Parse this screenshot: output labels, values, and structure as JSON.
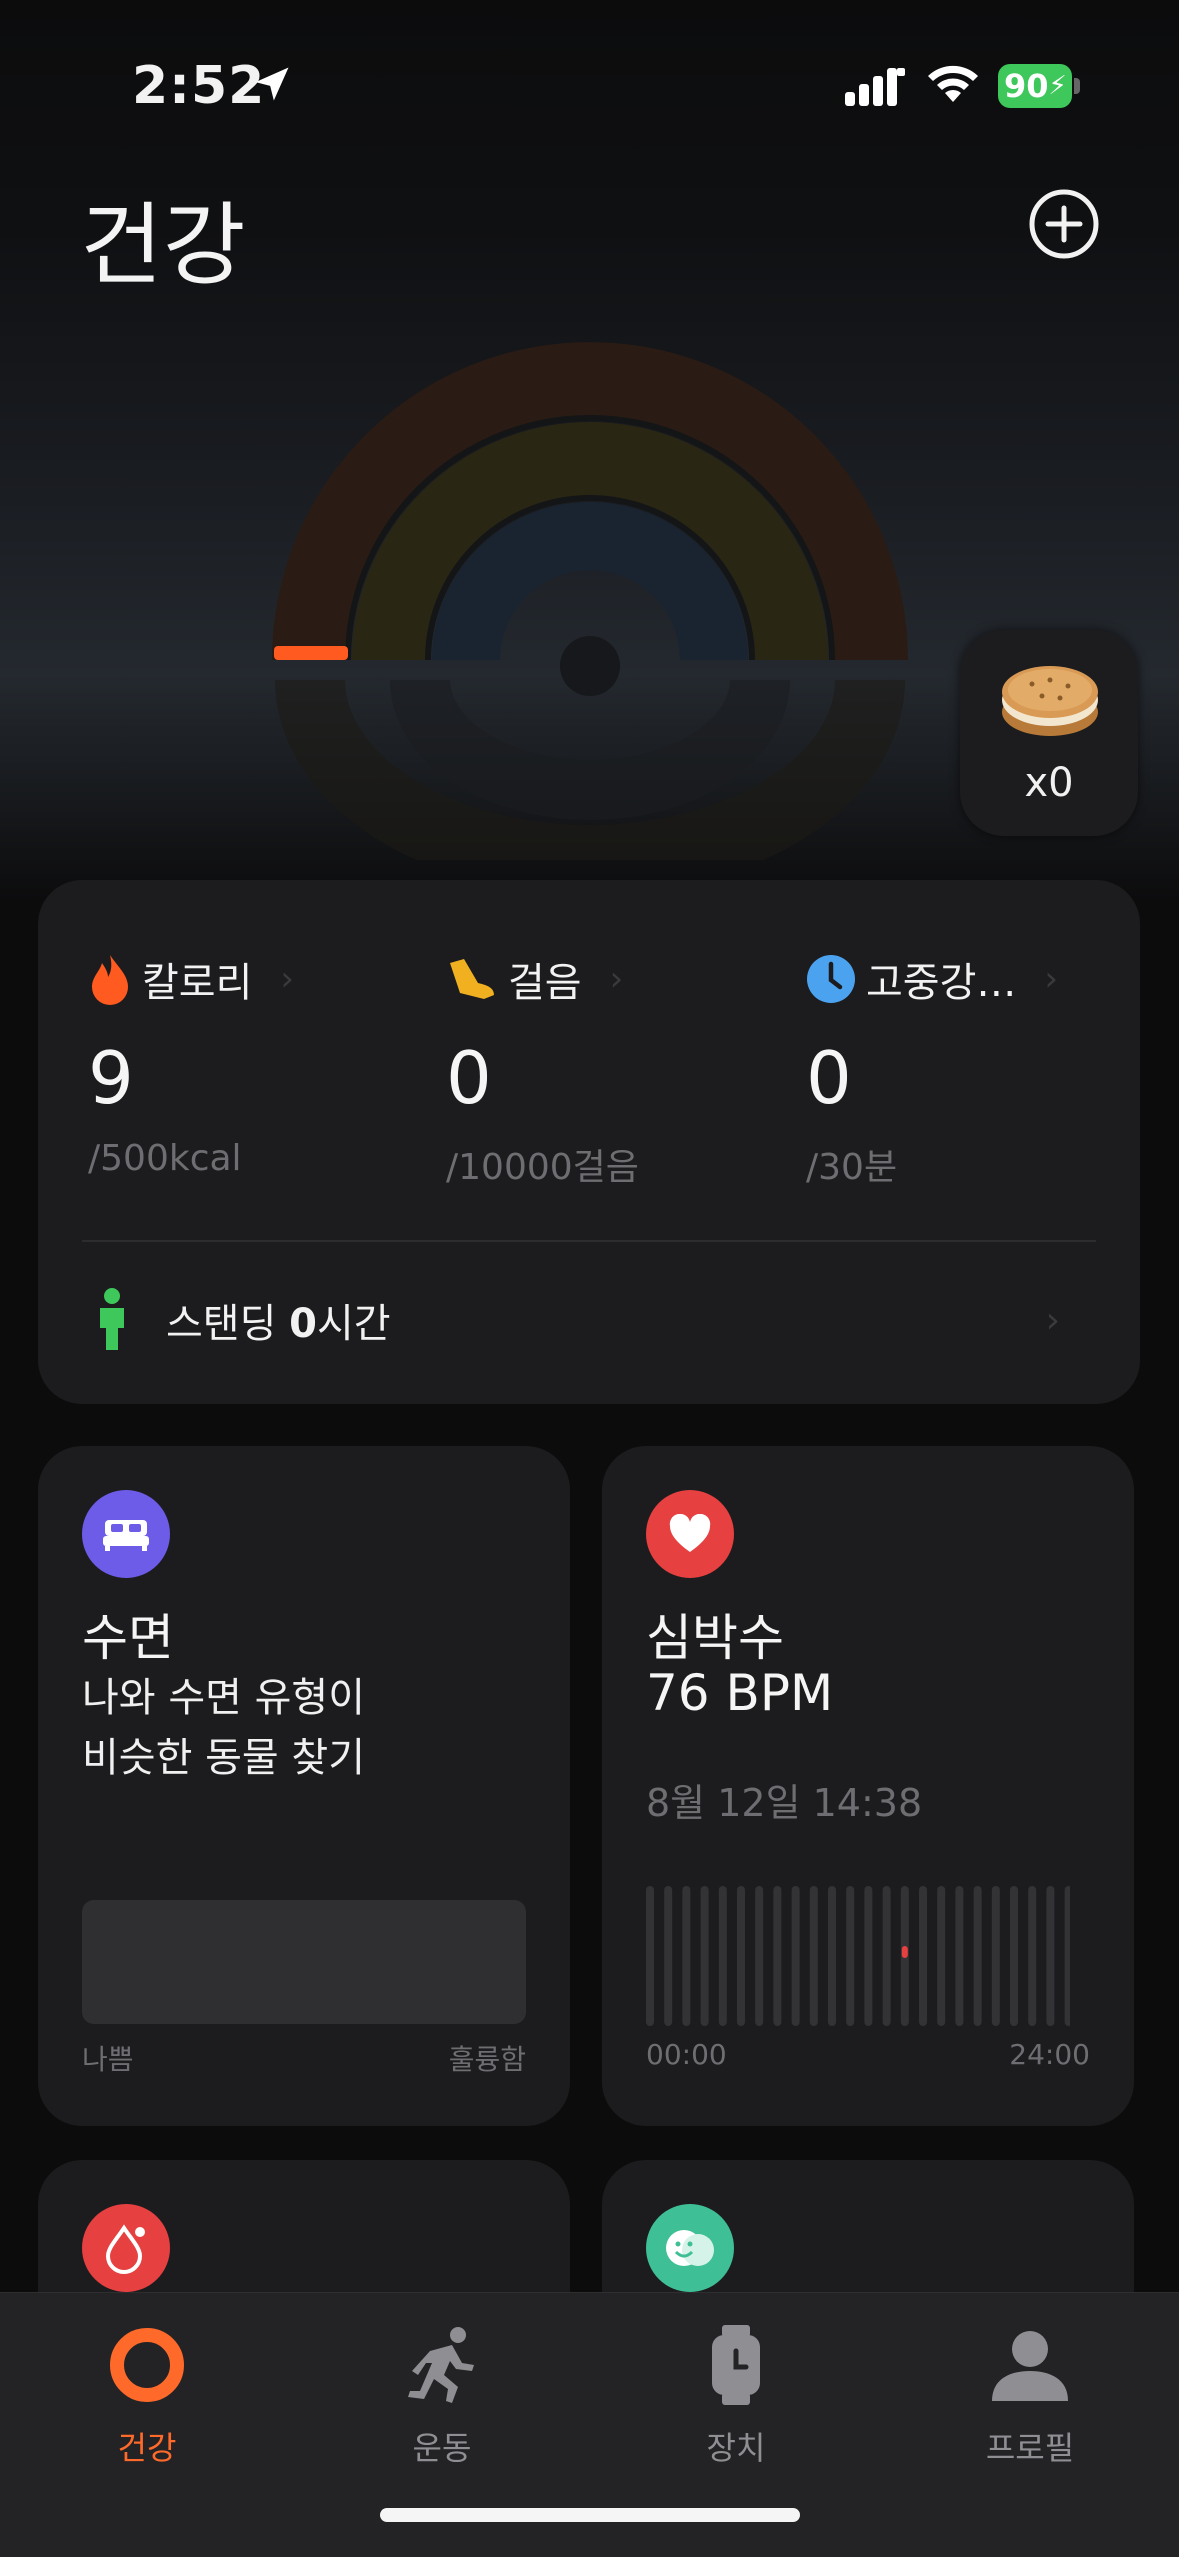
{
  "status_bar": {
    "time": "2:52",
    "battery": "90"
  },
  "header": {
    "title": "건강"
  },
  "coins": {
    "count_label": "x0"
  },
  "activity": {
    "metrics": [
      {
        "label": "칼로리",
        "value": "9",
        "goal": "/500kcal",
        "icon": "flame-icon"
      },
      {
        "label": "걸음",
        "value": "0",
        "goal": "/10000걸음",
        "icon": "shoe-icon"
      },
      {
        "label": "고중강…",
        "value": "0",
        "goal": "/30분",
        "icon": "clock-icon"
      }
    ],
    "standing": {
      "label": "스탠딩",
      "value": "0",
      "unit": "시간"
    }
  },
  "sleep": {
    "title": "수면",
    "line1": "나와 수면 유형이",
    "line2": "비슷한 동물 찾기",
    "scale_left": "나쁨",
    "scale_right": "훌륭함"
  },
  "heart": {
    "title": "심박수",
    "value": "76 BPM",
    "date": "8월 12일 14:38",
    "axis_start": "00:00",
    "axis_end": "24:00"
  },
  "tabs": [
    {
      "label": "건강",
      "active": true
    },
    {
      "label": "운동",
      "active": false
    },
    {
      "label": "장치",
      "active": false
    },
    {
      "label": "프로필",
      "active": false
    }
  ],
  "colors": {
    "accent": "#ff6a2b",
    "calorie_ring": "#ff5a1f",
    "steps_ring": "#e0a020",
    "intensity_ring": "#4ba3f0",
    "heart": "#e64040",
    "sleep": "#6c5ce7",
    "standing": "#3ec75a"
  }
}
